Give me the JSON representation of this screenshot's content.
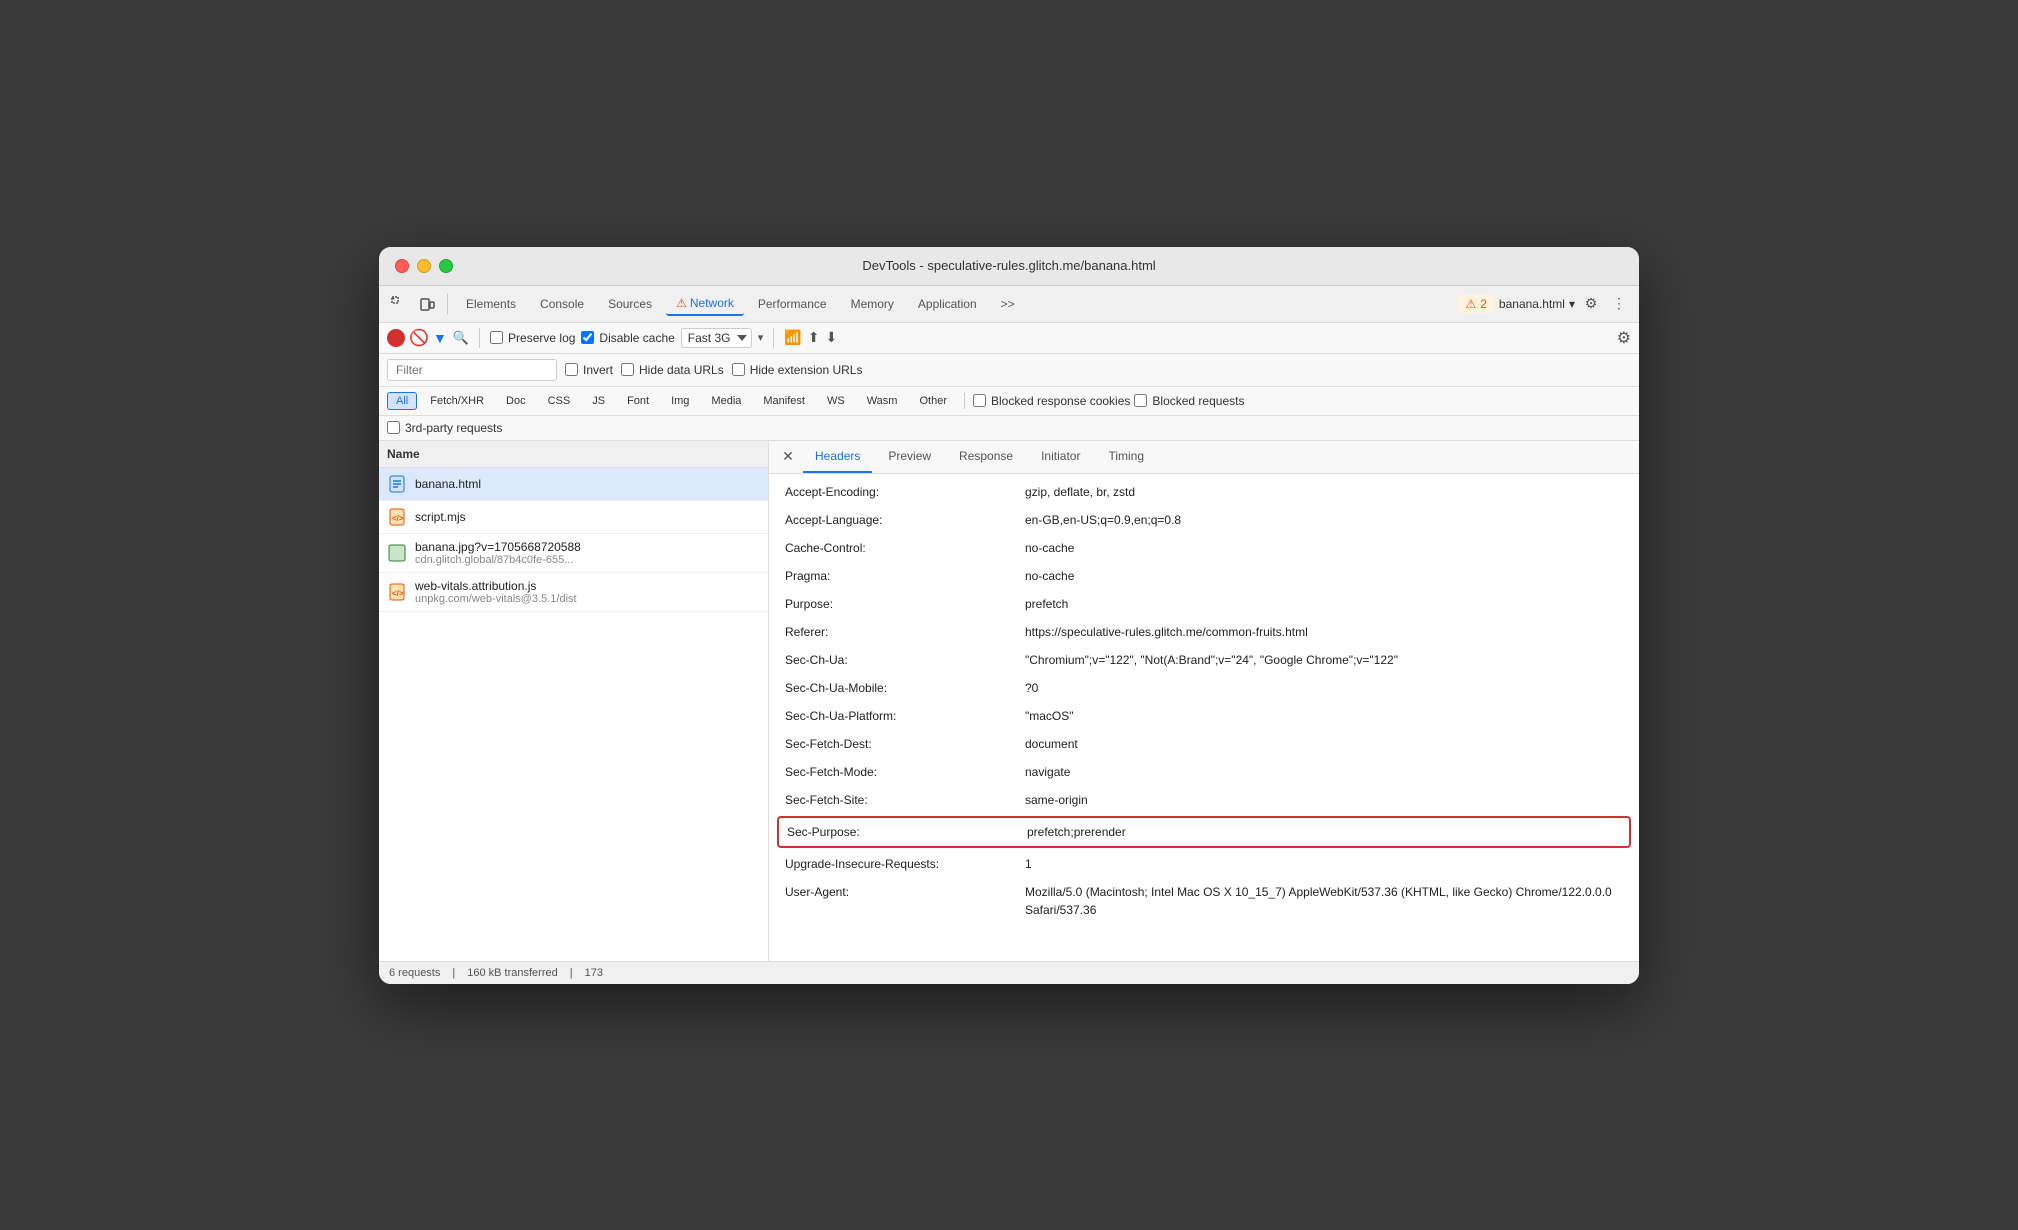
{
  "window": {
    "title": "DevTools - speculative-rules.glitch.me/banana.html"
  },
  "toolbar_top": {
    "tabs": [
      {
        "id": "elements",
        "label": "Elements",
        "active": false
      },
      {
        "id": "console",
        "label": "Console",
        "active": false
      },
      {
        "id": "sources",
        "label": "Sources",
        "active": false
      },
      {
        "id": "network",
        "label": "Network",
        "active": true
      },
      {
        "id": "performance",
        "label": "Performance",
        "active": false
      },
      {
        "id": "memory",
        "label": "Memory",
        "active": false
      },
      {
        "id": "application",
        "label": "Application",
        "active": false
      }
    ],
    "more_tabs": ">>",
    "warning_count": "2",
    "filename": "banana.html"
  },
  "toolbar_second": {
    "preserve_log_label": "Preserve log",
    "disable_cache_label": "Disable cache",
    "throttle_value": "Fast 3G"
  },
  "filter_row": {
    "filter_placeholder": "Filter",
    "invert_label": "Invert",
    "hide_data_urls_label": "Hide data URLs",
    "hide_extension_urls_label": "Hide extension URLs"
  },
  "type_filters": {
    "types": [
      "All",
      "Fetch/XHR",
      "Doc",
      "CSS",
      "JS",
      "Font",
      "Img",
      "Media",
      "Manifest",
      "WS",
      "Wasm",
      "Other"
    ],
    "active": "All",
    "blocked_cookies_label": "Blocked response cookies",
    "blocked_requests_label": "Blocked requests"
  },
  "third_party": {
    "label": "3rd-party requests"
  },
  "file_list": {
    "header": "Name",
    "files": [
      {
        "id": "banana-html",
        "name": "banana.html",
        "url": "",
        "type": "html",
        "selected": true
      },
      {
        "id": "script-mjs",
        "name": "script.mjs",
        "url": "",
        "type": "js",
        "selected": false
      },
      {
        "id": "banana-jpg",
        "name": "banana.jpg?v=1705668720588",
        "url": "cdn.glitch.global/87b4c0fe-655...",
        "type": "img",
        "selected": false
      },
      {
        "id": "web-vitals",
        "name": "web-vitals.attribution.js",
        "url": "unpkg.com/web-vitals@3.5.1/dist",
        "type": "js",
        "selected": false
      }
    ]
  },
  "headers_panel": {
    "tabs": [
      "Headers",
      "Preview",
      "Response",
      "Initiator",
      "Timing"
    ],
    "active_tab": "Headers",
    "headers": [
      {
        "name": "Accept-Encoding:",
        "value": "gzip, deflate, br, zstd",
        "highlighted": false
      },
      {
        "name": "Accept-Language:",
        "value": "en-GB,en-US;q=0.9,en;q=0.8",
        "highlighted": false
      },
      {
        "name": "Cache-Control:",
        "value": "no-cache",
        "highlighted": false
      },
      {
        "name": "Pragma:",
        "value": "no-cache",
        "highlighted": false
      },
      {
        "name": "Purpose:",
        "value": "prefetch",
        "highlighted": false
      },
      {
        "name": "Referer:",
        "value": "https://speculative-rules.glitch.me/common-fruits.html",
        "highlighted": false
      },
      {
        "name": "Sec-Ch-Ua:",
        "value": "\"Chromium\";v=\"122\", \"Not(A:Brand\";v=\"24\", \"Google Chrome\";v=\"122\"",
        "highlighted": false
      },
      {
        "name": "Sec-Ch-Ua-Mobile:",
        "value": "?0",
        "highlighted": false
      },
      {
        "name": "Sec-Ch-Ua-Platform:",
        "value": "\"macOS\"",
        "highlighted": false
      },
      {
        "name": "Sec-Fetch-Dest:",
        "value": "document",
        "highlighted": false
      },
      {
        "name": "Sec-Fetch-Mode:",
        "value": "navigate",
        "highlighted": false
      },
      {
        "name": "Sec-Fetch-Site:",
        "value": "same-origin",
        "highlighted": false
      },
      {
        "name": "Sec-Purpose:",
        "value": "prefetch;prerender",
        "highlighted": true
      },
      {
        "name": "Upgrade-Insecure-Requests:",
        "value": "1",
        "highlighted": false
      },
      {
        "name": "User-Agent:",
        "value": "Mozilla/5.0 (Macintosh; Intel Mac OS X 10_15_7) AppleWebKit/537.36 (KHTML, like Gecko) Chrome/122.0.0.0 Safari/537.36",
        "highlighted": false
      }
    ]
  },
  "status_bar": {
    "requests": "6 requests",
    "transferred": "160 kB transferred",
    "extra": "173"
  }
}
